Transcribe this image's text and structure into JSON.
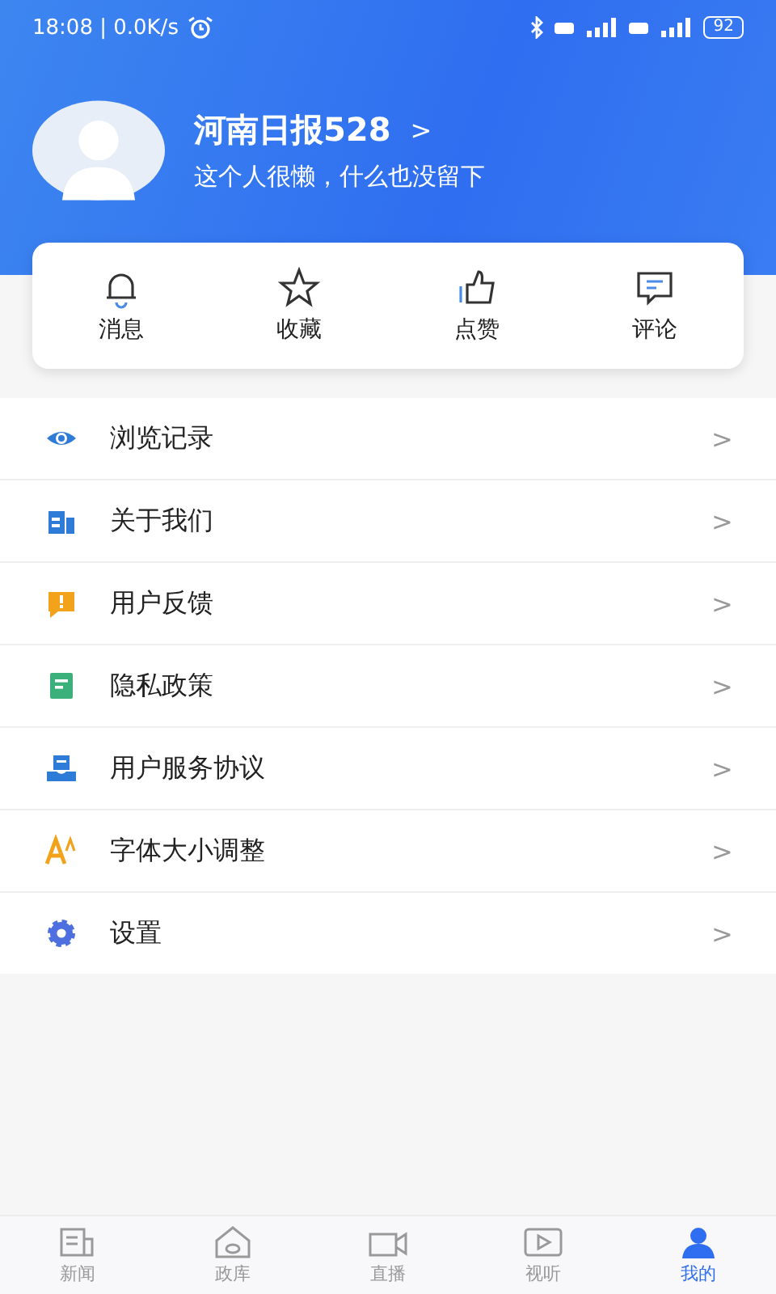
{
  "status_bar": {
    "time": "18:08 | 0.0K/s",
    "battery": "92"
  },
  "profile": {
    "name": "河南日报528",
    "chevron": ">",
    "bio": "这个人很懒，什么也没留下"
  },
  "quick_actions": [
    {
      "kind": "bell",
      "label": "消息"
    },
    {
      "kind": "star",
      "label": "收藏"
    },
    {
      "kind": "thumb",
      "label": "点赞"
    },
    {
      "kind": "comment",
      "label": "评论"
    }
  ],
  "menu": [
    {
      "kind": "eye",
      "label": "浏览记录",
      "chevron": ">"
    },
    {
      "kind": "building",
      "label": "关于我们",
      "chevron": ">"
    },
    {
      "kind": "feedback",
      "label": "用户反馈",
      "chevron": ">"
    },
    {
      "kind": "doc",
      "label": "隐私政策",
      "chevron": ">"
    },
    {
      "kind": "tray",
      "label": "用户服务协议",
      "chevron": ">"
    },
    {
      "kind": "font",
      "label": "字体大小调整",
      "chevron": ">"
    },
    {
      "kind": "gear",
      "label": "设置",
      "chevron": ">"
    }
  ],
  "bottom_nav": [
    {
      "kind": "news",
      "label": "新闻",
      "selected": false
    },
    {
      "kind": "home",
      "label": "政库",
      "selected": false
    },
    {
      "kind": "camera",
      "label": "直播",
      "selected": false
    },
    {
      "kind": "play",
      "label": "视听",
      "selected": false
    },
    {
      "kind": "person",
      "label": "我的",
      "selected": true
    }
  ]
}
